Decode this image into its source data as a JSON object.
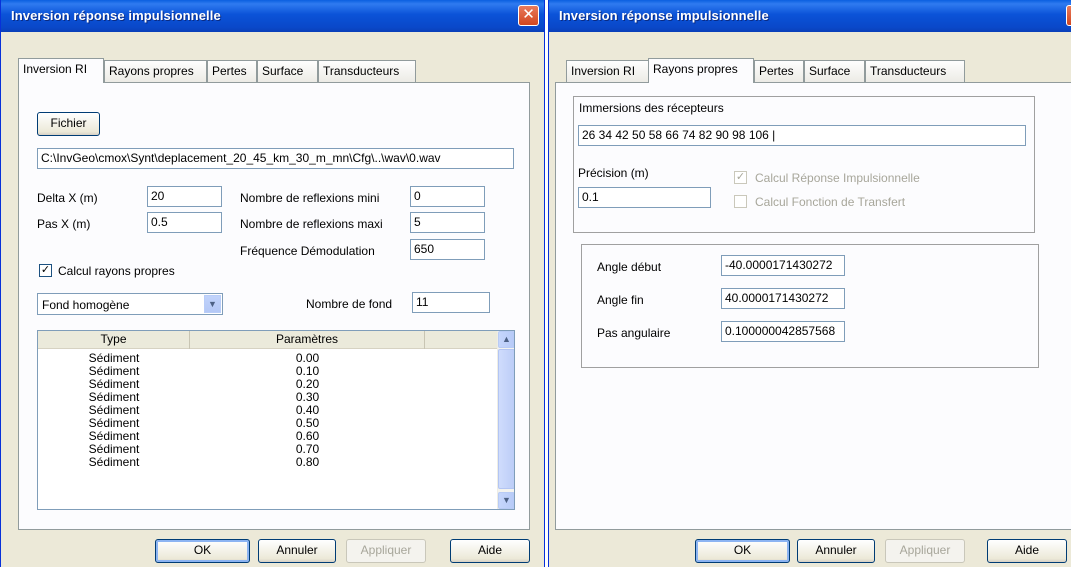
{
  "left": {
    "title": "Inversion réponse impulsionnelle",
    "close": "✕",
    "tabs": [
      "Inversion RI",
      "Rayons propres",
      "Pertes",
      "Surface",
      "Transducteurs"
    ],
    "fichier_button": "Fichier",
    "file_path": "C:\\InvGeo\\cmox\\Synt\\deplacement_20_45_km_30_m_mn\\Cfg\\..\\wav\\0.wav",
    "delta_x_label": "Delta X (m)",
    "delta_x": "20",
    "pas_x_label": "Pas X (m)",
    "pas_x": "0.5",
    "refl_mini_label": "Nombre de reflexions mini",
    "refl_mini": "0",
    "refl_maxi_label": "Nombre de reflexions maxi",
    "refl_maxi": "5",
    "freq_label": "Fréquence Démodulation",
    "freq": "650",
    "calc_rayons_label": "Calcul rayons propres",
    "calc_rayons_check": "✓",
    "fond_select": "Fond homogène",
    "nb_fond_label": "Nombre de fond",
    "nb_fond": "11",
    "table": {
      "headers": [
        "Type",
        "Paramètres"
      ],
      "rows": [
        [
          "Sédiment",
          "0.00"
        ],
        [
          "Sédiment",
          "0.10"
        ],
        [
          "Sédiment",
          "0.20"
        ],
        [
          "Sédiment",
          "0.30"
        ],
        [
          "Sédiment",
          "0.40"
        ],
        [
          "Sédiment",
          "0.50"
        ],
        [
          "Sédiment",
          "0.60"
        ],
        [
          "Sédiment",
          "0.70"
        ],
        [
          "Sédiment",
          "0.80"
        ]
      ]
    },
    "buttons": {
      "ok": "OK",
      "annuler": "Annuler",
      "appliquer": "Appliquer",
      "aide": "Aide"
    }
  },
  "right": {
    "title": "Inversion réponse impulsionnelle",
    "close": "✕",
    "tabs": [
      "Inversion RI",
      "Rayons propres",
      "Pertes",
      "Surface",
      "Transducteurs"
    ],
    "immersions_label": "Immersions des récepteurs",
    "immersions": "26 34 42 50 58 66 74 82 90 98 106 |",
    "precision_label": "Précision (m)",
    "precision": "0.1",
    "calc_ri_label": "Calcul Réponse Impulsionnelle",
    "calc_ri_check": "✓",
    "calc_ft_label": "Calcul Fonction de Transfert",
    "angle_debut_label": "Angle début",
    "angle_debut": "-40.0000171430272",
    "angle_fin_label": "Angle fin",
    "angle_fin": "40.0000171430272",
    "pas_ang_label": "Pas angulaire",
    "pas_ang": "0.100000042857568",
    "buttons": {
      "ok": "OK",
      "annuler": "Annuler",
      "appliquer": "Appliquer",
      "aide": "Aide"
    }
  },
  "colors": {
    "titlebar": "#0a48c9",
    "dialog_bg": "#ece9d8",
    "close": "#d2461f"
  }
}
